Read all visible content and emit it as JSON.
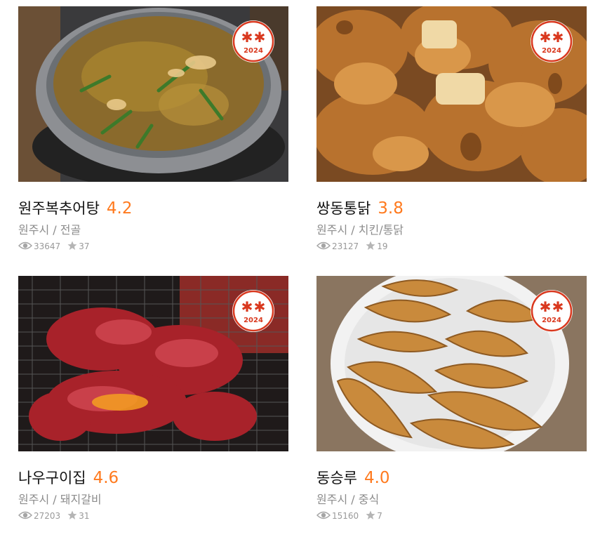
{
  "badge": {
    "year": "2024",
    "color": "#d9381e"
  },
  "rating_color": "#ff7a1e",
  "icons": {
    "views": "eye-icon",
    "likes": "star-icon"
  },
  "restaurants": [
    {
      "name": "원주복추어탕",
      "rating": "4.2",
      "location": "원주시",
      "sep": "/",
      "category": "전골",
      "views": "33647",
      "likes": "37",
      "photo": "loach-soup-hotpot"
    },
    {
      "name": "쌍동통닭",
      "rating": "3.8",
      "location": "원주시",
      "sep": "/",
      "category": "치킨/통닭",
      "views": "23127",
      "likes": "19",
      "photo": "fried-chicken"
    },
    {
      "name": "나우구이집",
      "rating": "4.6",
      "location": "원주시",
      "sep": "/",
      "category": "돼지갈비",
      "views": "27203",
      "likes": "31",
      "photo": "grilled-meat"
    },
    {
      "name": "동승루",
      "rating": "4.0",
      "location": "원주시",
      "sep": "/",
      "category": "중식",
      "views": "15160",
      "likes": "7",
      "photo": "fried-dumplings"
    }
  ]
}
